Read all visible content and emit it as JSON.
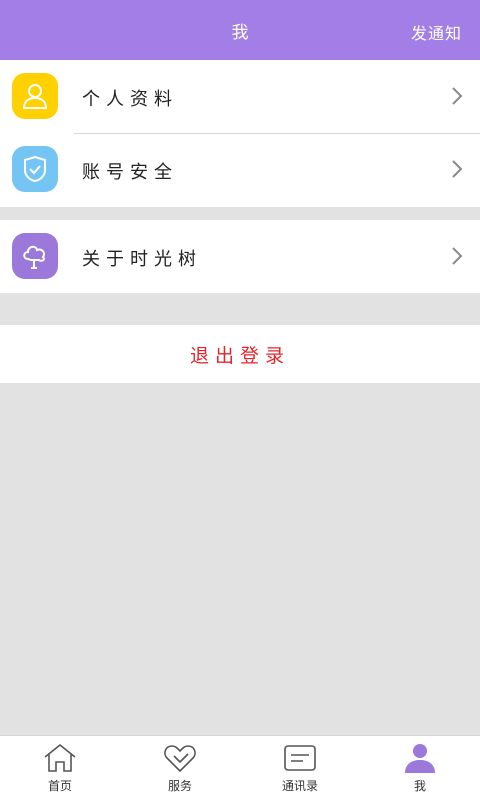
{
  "header": {
    "title": "我",
    "action": "发通知"
  },
  "groups": {
    "profile": {
      "label": "个人资料",
      "icon": "user-icon",
      "color": "#ffd100"
    },
    "security": {
      "label": "账号安全",
      "icon": "shield-check-icon",
      "color": "#74c5f3"
    },
    "about": {
      "label": "关于时光树",
      "icon": "tree-icon",
      "color": "#9b78d9"
    }
  },
  "logout": {
    "label": "退出登录",
    "color": "#e3262e"
  },
  "tabbar": {
    "tabs": [
      {
        "label": "首页",
        "icon": "home-icon"
      },
      {
        "label": "服务",
        "icon": "heart-icon"
      },
      {
        "label": "通讯录",
        "icon": "contacts-icon"
      },
      {
        "label": "我",
        "icon": "me-icon",
        "active": true
      }
    ]
  },
  "colors": {
    "accent": "#a27ee6",
    "background": "#e2e2e2"
  }
}
